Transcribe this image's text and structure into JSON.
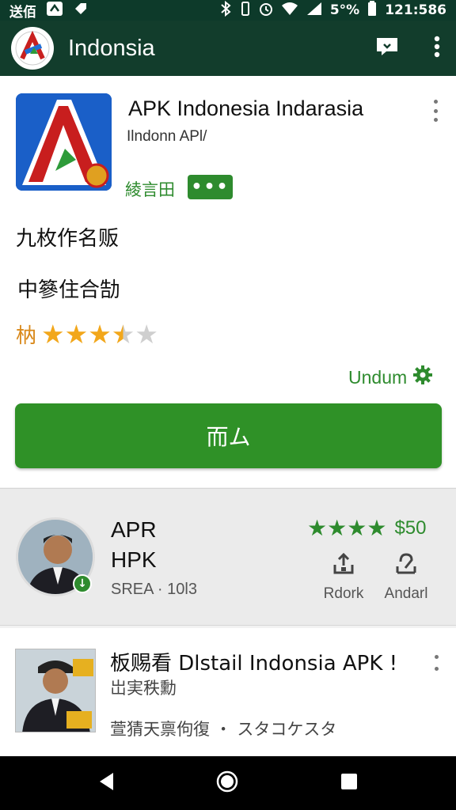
{
  "status_bar": {
    "left_text": "送佰",
    "battery_percent": "5°%",
    "time": "121:586"
  },
  "app_bar": {
    "title": "Indonsia",
    "icons": [
      "app-logo-icon",
      "message-icon",
      "more-vert-icon"
    ]
  },
  "detail": {
    "app_name": "APK Indonesia Indarasia",
    "developer": "Ilndonn APl/",
    "category": "綾言田",
    "more_label": "•••",
    "line1": "九枚作名贩",
    "line2": "中篸住合勂",
    "rating_label": "枘",
    "rating": 3.5,
    "rating_max": 5,
    "undum_label": "Undum",
    "install_label": "而ム",
    "colors": {
      "accent": "#2e8b2e",
      "star": "#f2a71b",
      "install": "#2f9127"
    }
  },
  "recommended": {
    "title_line1": "APR",
    "title_line2": "HPK",
    "meta": "SREA · 10l3",
    "rating": 4,
    "rating_max": 4,
    "price": "$50",
    "actions": [
      {
        "label": "Rdork",
        "icon": "download-tray-icon"
      },
      {
        "label": "Andarl",
        "icon": "share-upload-icon"
      }
    ]
  },
  "list_item": {
    "title": "板赐看 Dlstail Indonsia APK !",
    "subtitle": "岀実秩勳",
    "meta": "萱猜天禀佝復 ・ スタコケスタ"
  },
  "nav_bar": {
    "icons": [
      "back-icon",
      "home-icon",
      "recents-icon"
    ]
  }
}
